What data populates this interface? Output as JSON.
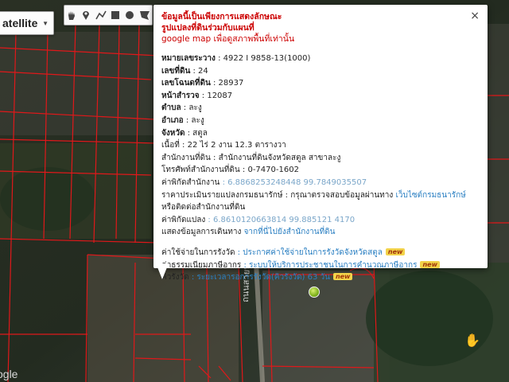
{
  "map": {
    "type_selector": {
      "label": "atellite"
    },
    "tools": [
      {
        "name": "hand-icon",
        "glyph": "✋"
      },
      {
        "name": "marker-icon",
        "glyph": "📍"
      },
      {
        "name": "polyline-icon",
        "glyph": "〰"
      },
      {
        "name": "rectangle-icon",
        "glyph": "■"
      },
      {
        "name": "circle-icon",
        "glyph": "●"
      },
      {
        "name": "polygon-icon",
        "glyph": "⬟"
      }
    ],
    "logo_text": "ogle"
  },
  "popup": {
    "notice": [
      "ข้อมูลนี้เป็นเพียงการแสดงลักษณะ",
      "รูปแปลงที่ดินร่วมกับแผนที่",
      "google map เพื่อดูสภาพพื้นที่เท่านั้น"
    ],
    "fields": [
      {
        "label": "หมายเลขระวาง",
        "value": " : 4922 I 9858-13(1000)"
      },
      {
        "label": "เลขที่ดิน",
        "value": " : 24"
      },
      {
        "label": "เลขโฉนดที่ดิน",
        "value": " : 28937"
      },
      {
        "label": "หน้าสำรวจ",
        "value": " : 12087"
      },
      {
        "label": "ตำบล",
        "value": " : ละงู"
      },
      {
        "label": "อำเภอ",
        "value": " : ละงู"
      },
      {
        "label": "จังหวัด",
        "value": " : สตูล"
      },
      {
        "label": "เนื้อที่",
        "value": " : 22 ไร่ 2 งาน 12.3 ตารางวา"
      },
      {
        "label": "สำนักงานที่ดิน",
        "value": " : สำนักงานที่ดินจังหวัดสตูล สาขาละงู"
      },
      {
        "label": "โทรศัพท์สำนักงานที่ดิน",
        "value": " : 0-7470-1602"
      }
    ],
    "office_coord": {
      "label": "ค่าพิกัดสำนักงาน",
      "value": " : 6.8868253248448 99.7849035507"
    },
    "valuation": {
      "text": "ราคาประเมินรายแปลงกรมธนารักษ์ : กรุณาตรวจสอบข้อมูลผ่านทาง",
      "link": "เว็บไซต์กรมธนารักษ์",
      "text2": "หรือติดต่อสำนักงานที่ดิน"
    },
    "parcel_coord": {
      "label": "ค่าพิกัดแปลง",
      "value": " : 6.8610120663814 99.885121 4170"
    },
    "route": {
      "label": "แสดงข้อมูลการเดินทาง",
      "link": "จากที่นี่ไปยังสำนักงานที่ดิน"
    },
    "services": [
      {
        "label": "ค่าใช้จ่ายในการรังวัด",
        "value": " : ประกาศค่าใช้จ่ายในการรังวัดจังหวัดสตูล",
        "badge": "new"
      },
      {
        "label": "ค่าธรรมเนียมภาษีอากร",
        "value": " : ระบบให้บริการประชาชนในการคำนวณภาษีอากร",
        "badge": "new"
      },
      {
        "label": "คิวรังวัด",
        "value": " : ระยะเวลารอการรังวัด(คิวรังวัด) 63 วัน",
        "badge": "new"
      }
    ],
    "close_glyph": "×",
    "colors": {
      "notice": "#cc0000",
      "link": "#2a7fc2",
      "badge_bg": "#f3d34a"
    }
  }
}
